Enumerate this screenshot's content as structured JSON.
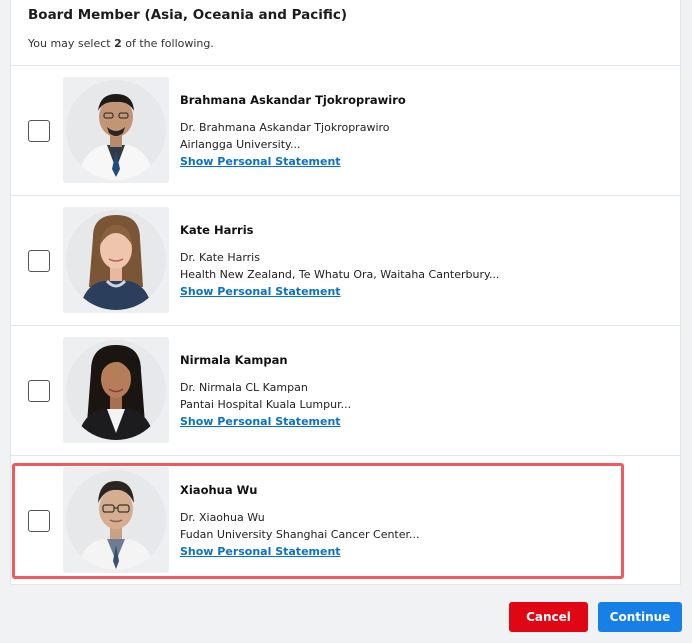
{
  "section": {
    "title": "Board Member (Asia, Oceania and Pacific)",
    "instruction_prefix": "You may select ",
    "instruction_count": "2",
    "instruction_suffix": " of the following."
  },
  "candidates": [
    {
      "name": "Brahmana Askandar Tjokroprawiro",
      "full_name": "Dr. Brahmana Askandar Tjokroprawiro",
      "organization": "Airlangga University...",
      "link_label": "Show Personal Statement",
      "checked": false
    },
    {
      "name": "Kate Harris",
      "full_name": "Dr. Kate Harris",
      "organization": "Health New Zealand, Te Whatu Ora, Waitaha Canterbury...",
      "link_label": "Show Personal Statement",
      "checked": false
    },
    {
      "name": "Nirmala Kampan",
      "full_name": "Dr. Nirmala CL Kampan",
      "organization": "Pantai Hospital Kuala Lumpur...",
      "link_label": "Show Personal Statement",
      "checked": false
    },
    {
      "name": "Xiaohua Wu",
      "full_name": "Dr. Xiaohua Wu",
      "organization": "Fudan University Shanghai Cancer Center...",
      "link_label": "Show Personal Statement",
      "checked": false
    }
  ],
  "actions": {
    "cancel_label": "Cancel",
    "continue_label": "Continue"
  },
  "colors": {
    "cancel": "#e10613",
    "continue": "#1680e6",
    "link": "#0a72c4",
    "highlight": "#ef5a61"
  }
}
